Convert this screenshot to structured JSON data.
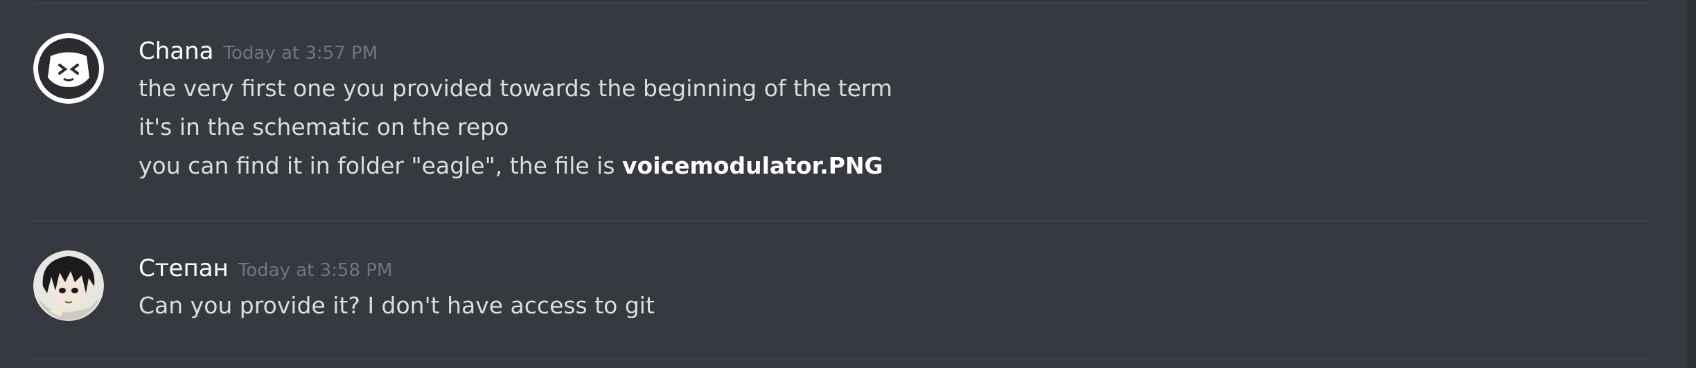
{
  "messages": [
    {
      "author": "Chana",
      "timestamp": "Today at 3:57 PM",
      "avatar_icon": "discord-default-avatar-icon",
      "lines": [
        {
          "text": "the very first one you provided towards the beginning of the term"
        },
        {
          "text": "it's in the schematic on the repo"
        },
        {
          "text": "you can find it in folder \"eagle\", the file is ",
          "bold": "voicemodulator.PNG"
        }
      ]
    },
    {
      "author": "Степан",
      "timestamp": "Today at 3:58 PM",
      "avatar_icon": "anime-character-avatar-icon",
      "lines": [
        {
          "text": "Can you provide it? I don't have access to git"
        }
      ]
    }
  ],
  "colors": {
    "background": "#36393f",
    "divider": "#40434a",
    "username": "#ffffff",
    "timestamp": "#72767d",
    "message_text": "#dcddde"
  }
}
